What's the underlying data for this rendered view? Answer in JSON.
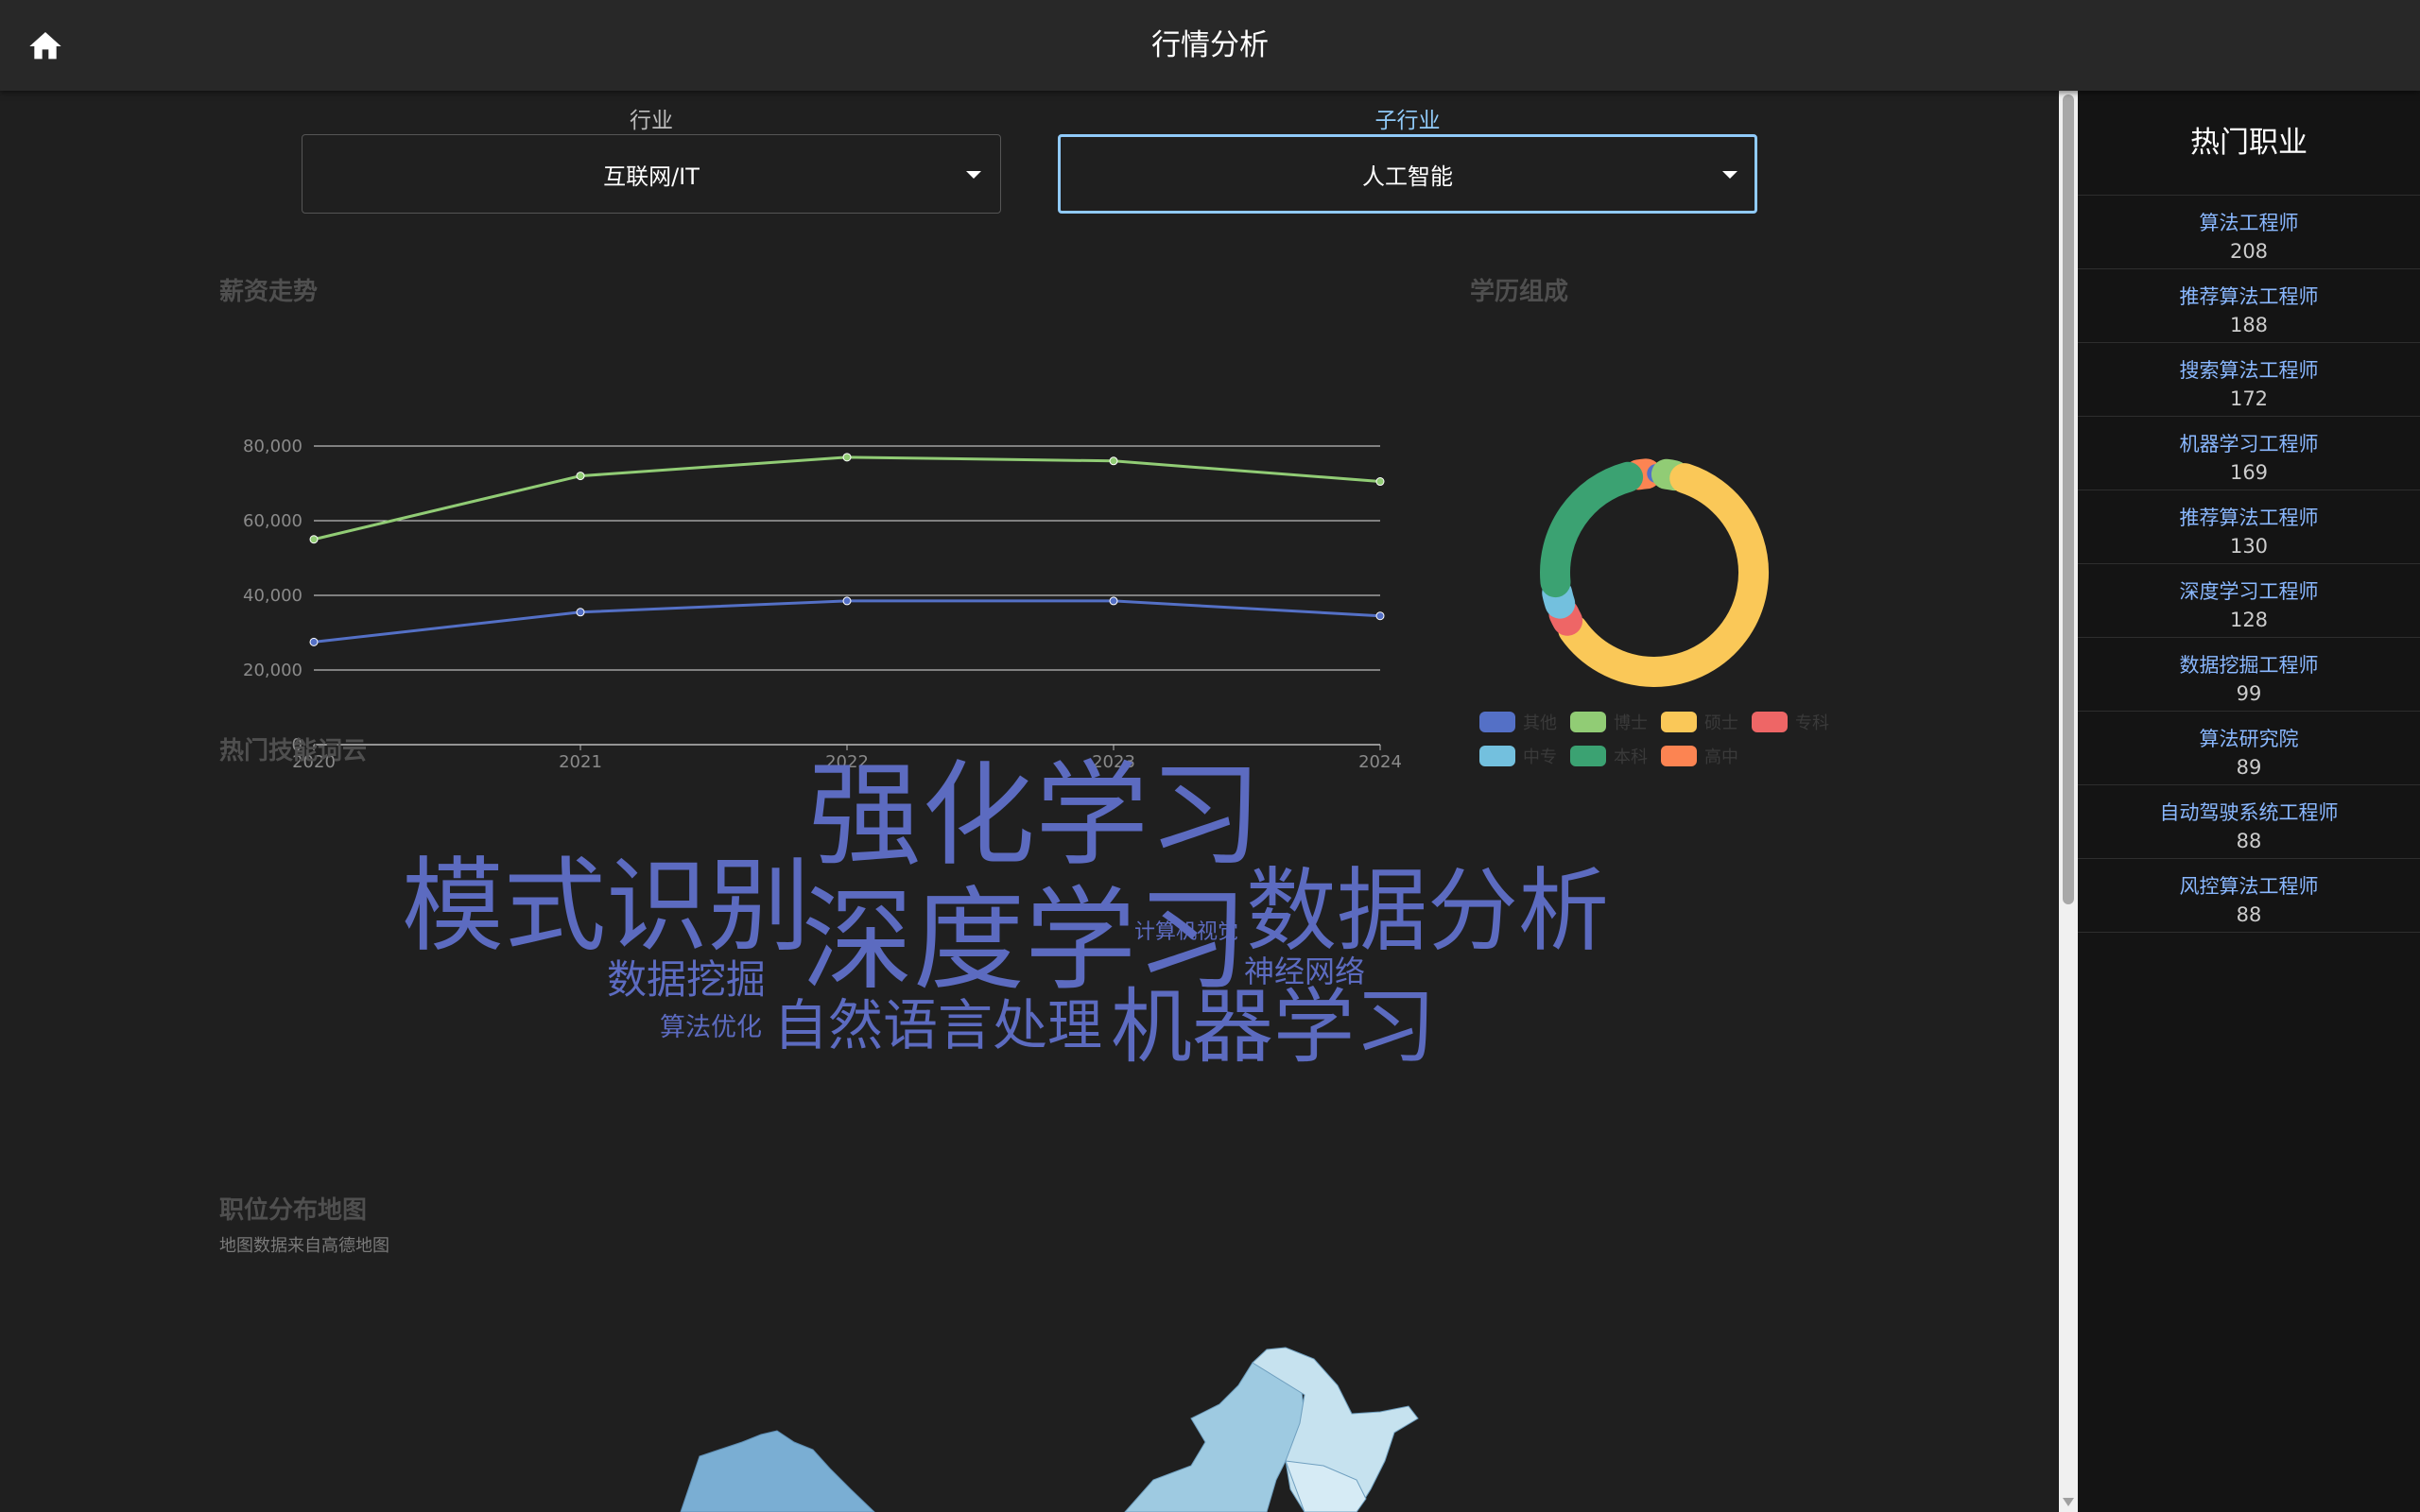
{
  "header": {
    "title": "行情分析"
  },
  "filters": {
    "industry": {
      "label": "行业",
      "value": "互联网/IT"
    },
    "sub_industry": {
      "label": "子行业",
      "value": "人工智能"
    }
  },
  "sections": {
    "salary": "薪资走势",
    "education": "学历组成",
    "skills": "热门技能词云",
    "map": "职位分布地图",
    "map_source": "地图数据来自高德地图"
  },
  "sidebar": {
    "title": "热门职业",
    "jobs": [
      {
        "name": "算法工程师",
        "count": "208"
      },
      {
        "name": "推荐算法工程师",
        "count": "188"
      },
      {
        "name": "搜索算法工程师",
        "count": "172"
      },
      {
        "name": "机器学习工程师",
        "count": "169"
      },
      {
        "name": "推荐算法工程师",
        "count": "130"
      },
      {
        "name": "深度学习工程师",
        "count": "128"
      },
      {
        "name": "数据挖掘工程师",
        "count": "99"
      },
      {
        "name": "算法研究院",
        "count": "89"
      },
      {
        "name": "自动驾驶系统工程师",
        "count": "88"
      },
      {
        "name": "风控算法工程师",
        "count": "88"
      }
    ]
  },
  "word_cloud": [
    {
      "text": "强化学习",
      "weight": 100
    },
    {
      "text": "深度学习",
      "weight": 100
    },
    {
      "text": "模式识别",
      "weight": 95
    },
    {
      "text": "数据分析",
      "weight": 88
    },
    {
      "text": "机器学习",
      "weight": 80
    },
    {
      "text": "自然语言处理",
      "weight": 56
    },
    {
      "text": "数据挖掘",
      "weight": 40
    },
    {
      "text": "神经网络",
      "weight": 30
    },
    {
      "text": "算法优化",
      "weight": 24
    },
    {
      "text": "计算机视觉",
      "weight": 21
    }
  ],
  "colors": {
    "accent": "#90caf9",
    "job_name": "#8ab8ff",
    "word": "#5c6bc0"
  },
  "chart_data": [
    {
      "type": "line",
      "x": [
        "2020",
        "2021",
        "2022",
        "2023",
        "2024"
      ],
      "series": [
        {
          "values": [
            55000,
            72000,
            77000,
            76000,
            70500
          ],
          "color": "#91cc75"
        },
        {
          "values": [
            27500,
            35500,
            38500,
            38500,
            34500
          ],
          "color": "#5470c6"
        }
      ],
      "yticks": [
        "0",
        "20,000",
        "40,000",
        "60,000",
        "80,000"
      ],
      "ylim": [
        0,
        80000
      ],
      "grid": true
    },
    {
      "type": "pie",
      "donut": true,
      "slices": [
        {
          "label": "其他",
          "value": 1.5,
          "color": "#5470c6"
        },
        {
          "label": "博士",
          "value": 3,
          "color": "#91cc75"
        },
        {
          "label": "硕士",
          "value": 62,
          "color": "#fac858"
        },
        {
          "label": "专科",
          "value": 3,
          "color": "#ee6666"
        },
        {
          "label": "中专",
          "value": 3.5,
          "color": "#73c0de"
        },
        {
          "label": "本科",
          "value": 24,
          "color": "#3ba272"
        },
        {
          "label": "高中",
          "value": 3,
          "color": "#fc8452"
        }
      ],
      "legend_position": "bottom"
    }
  ]
}
